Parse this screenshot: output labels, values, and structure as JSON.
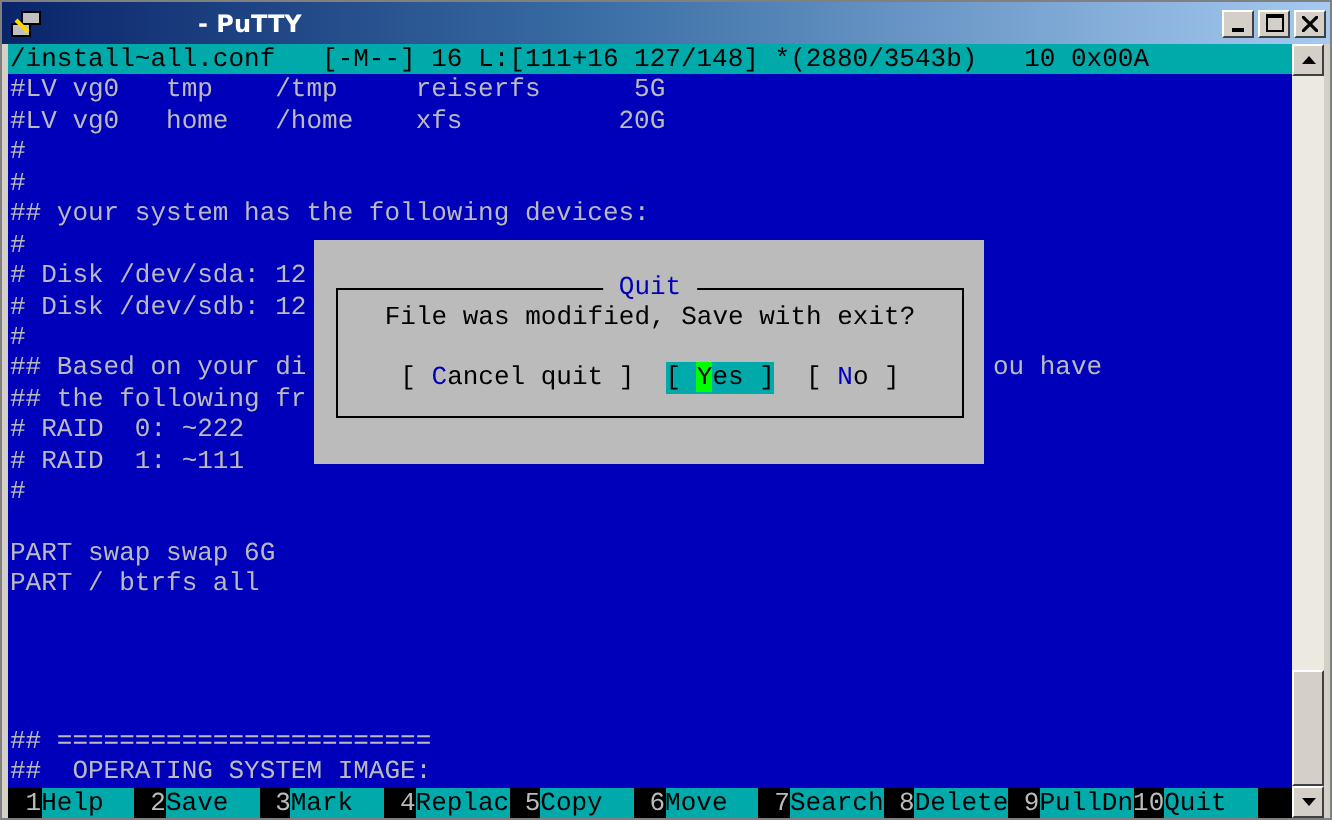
{
  "window": {
    "title": "- PuTTY"
  },
  "status_line": "/install~all.conf   [-M--] 16 L:[111+16 127/148] *(2880/3543b)   10 0x00A",
  "line_blocks": [
    {
      "lines": [
        {
          "text": "#LV vg0   tmp    /tmp     reiserfs      5G"
        },
        {
          "text": "#LV vg0   home   /home    xfs          20G"
        },
        {
          "text": "#"
        },
        {
          "text": "#"
        },
        {
          "text": "## your system has the following devices:"
        },
        {
          "text": "#"
        },
        {
          "text": "# Disk /dev/sda: 12"
        },
        {
          "text": "# Disk /dev/sdb: 12"
        },
        {
          "text": "#"
        },
        {
          "text": "## Based on your di",
          "tail": "ou have"
        },
        {
          "text": "## the following fr"
        },
        {
          "text": "# RAID  0: ~222"
        },
        {
          "text": "# RAID  1: ~111"
        },
        {
          "text": "#"
        }
      ]
    },
    {
      "lines": [
        {
          "text": "PART swap swap 6G"
        },
        {
          "text": "PART / btrfs all"
        }
      ]
    },
    {
      "lines": [
        {
          "text": "## ========================"
        },
        {
          "text": "##  OPERATING SYSTEM IMAGE:"
        }
      ]
    }
  ],
  "dialog": {
    "title": "Quit",
    "message": "File was modified, Save with exit?",
    "buttons": [
      {
        "prefix": "[ ",
        "hotkey": "C",
        "suffix": "ancel quit ]",
        "selected": false
      },
      {
        "prefix": "[ ",
        "hotkey": "Y",
        "suffix": "es ]",
        "selected": true
      },
      {
        "prefix": "[ ",
        "hotkey": "N",
        "suffix": "o ]",
        "selected": false
      }
    ]
  },
  "function_keys": [
    {
      "key": "1",
      "label": "Help"
    },
    {
      "key": "2",
      "label": "Save"
    },
    {
      "key": "3",
      "label": "Mark"
    },
    {
      "key": "4",
      "label": "Replac"
    },
    {
      "key": "5",
      "label": "Copy"
    },
    {
      "key": "6",
      "label": "Move"
    },
    {
      "key": "7",
      "label": "Search"
    },
    {
      "key": "8",
      "label": "Delete"
    },
    {
      "key": "9",
      "label": "PullDn"
    },
    {
      "key": "10",
      "label": "Quit"
    }
  ]
}
